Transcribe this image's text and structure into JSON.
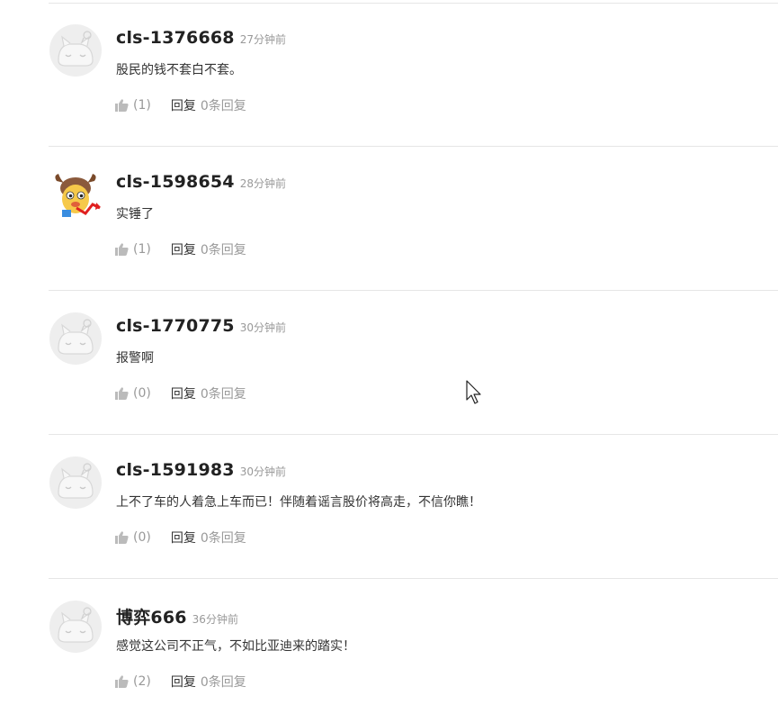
{
  "colors": {
    "username": "#222222",
    "meta": "#999999",
    "text": "#333333",
    "divider": "#e6e6e6"
  },
  "comments": [
    {
      "username": "cls-1376668",
      "time": "27分钟前",
      "content": "股民的钱不套白不套。",
      "likes": "(1)",
      "reply_label": "回复",
      "reply_count": "0条回复",
      "avatar": "default-cat-avatar"
    },
    {
      "username": "cls-1598654",
      "time": "28分钟前",
      "content": "实锤了",
      "likes": "(1)",
      "reply_label": "回复",
      "reply_count": "0条回复",
      "avatar": "cartoon-bull-avatar"
    },
    {
      "username": "cls-1770775",
      "time": "30分钟前",
      "content": "报警啊",
      "likes": "(0)",
      "reply_label": "回复",
      "reply_count": "0条回复",
      "avatar": "default-cat-avatar"
    },
    {
      "username": "cls-1591983",
      "time": "30分钟前",
      "content": "上不了车的人着急上车而已！伴随着谣言股价将高走，不信你瞧！",
      "likes": "(0)",
      "reply_label": "回复",
      "reply_count": "0条回复",
      "avatar": "default-cat-avatar"
    },
    {
      "username": "博弈666",
      "time": "36分钟前",
      "content": "感觉这公司不正气，不如比亚迪来的踏实！",
      "likes": "(2)",
      "reply_label": "回复",
      "reply_count": "0条回复",
      "avatar": "default-cat-avatar"
    }
  ]
}
